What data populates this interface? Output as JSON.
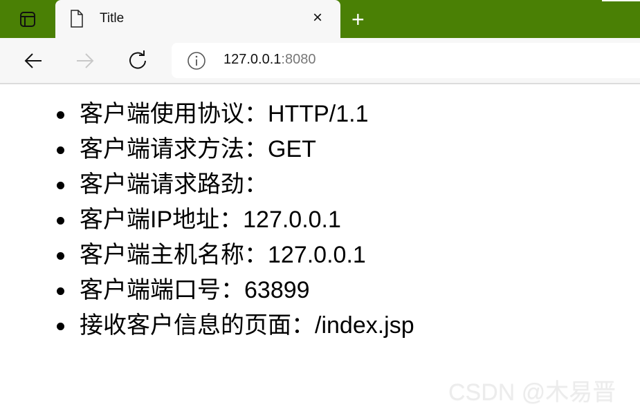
{
  "browser": {
    "theme_color": "#4a8005",
    "tab": {
      "title": "Title",
      "icon": "document-icon",
      "close_label": "×"
    },
    "new_tab_label": "+",
    "address": {
      "host": "127.0.0.1",
      "port": ":8080",
      "icon": "info-icon"
    }
  },
  "content": {
    "items": [
      "客户端使用协议：HTTP/1.1",
      "客户端请求方法：GET",
      "客户端请求路劲：",
      "客户端IP地址：127.0.0.1",
      "客户端主机名称：127.0.0.1",
      "客户端端口号：63899",
      "接收客户信息的页面：/index.jsp"
    ]
  },
  "watermark": "CSDN @木易晋"
}
